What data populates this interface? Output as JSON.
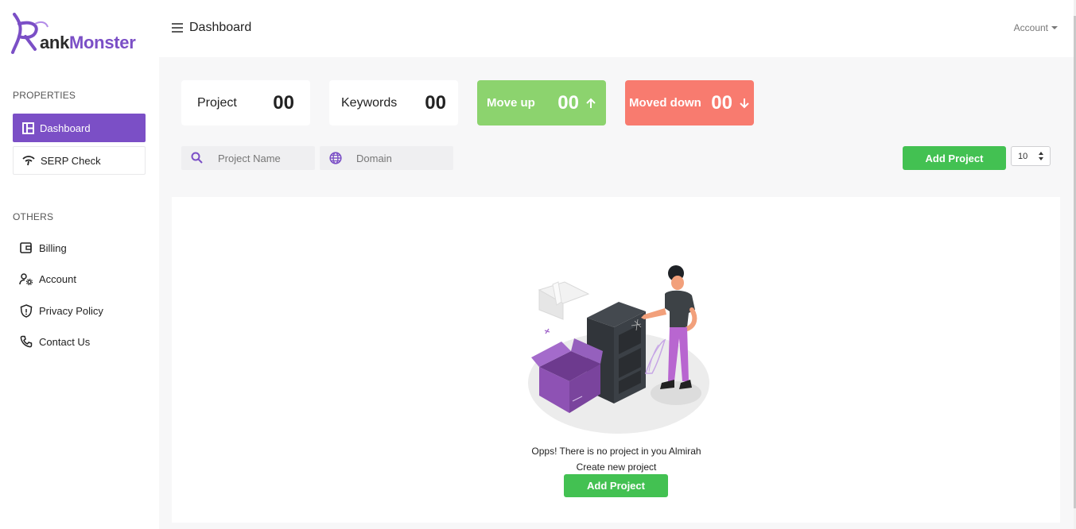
{
  "brand": {
    "name_prefix": "R",
    "name_part1": "ank",
    "name_part2": "Monster",
    "accent": "#7b4fc6"
  },
  "sidebar": {
    "sections": [
      {
        "label": "PROPERTIES"
      },
      {
        "label": "OTHERS"
      }
    ],
    "properties_items": [
      {
        "label": "Dashboard",
        "icon": "dashboard-icon"
      },
      {
        "label": "SERP Check",
        "icon": "wifi-icon"
      }
    ],
    "others_items": [
      {
        "label": "Billing",
        "icon": "wallet-icon"
      },
      {
        "label": "Account",
        "icon": "user-settings-icon"
      },
      {
        "label": "Privacy Policy",
        "icon": "shield-icon"
      },
      {
        "label": "Contact Us",
        "icon": "phone-icon"
      }
    ]
  },
  "header": {
    "title": "Dashboard",
    "account_label": "Account"
  },
  "stats": [
    {
      "label": "Project",
      "value": "00"
    },
    {
      "label": "Keywords",
      "value": "00"
    },
    {
      "label": "Move up",
      "value": "00",
      "color": "#8cd36e"
    },
    {
      "label": "Moved down",
      "value": "00",
      "color": "#f87b6f"
    }
  ],
  "filters": {
    "project_placeholder": "Project Name",
    "domain_placeholder": "Domain"
  },
  "toolbar": {
    "add_project_label": "Add Project",
    "page_size": "10"
  },
  "empty_state": {
    "line1": "Opps! There is no project in you Almirah",
    "line2": "Create new project",
    "button_label": "Add Project"
  },
  "colors": {
    "primary_green": "#43c152",
    "move_up": "#8cd36e",
    "move_down": "#f87b6f"
  }
}
